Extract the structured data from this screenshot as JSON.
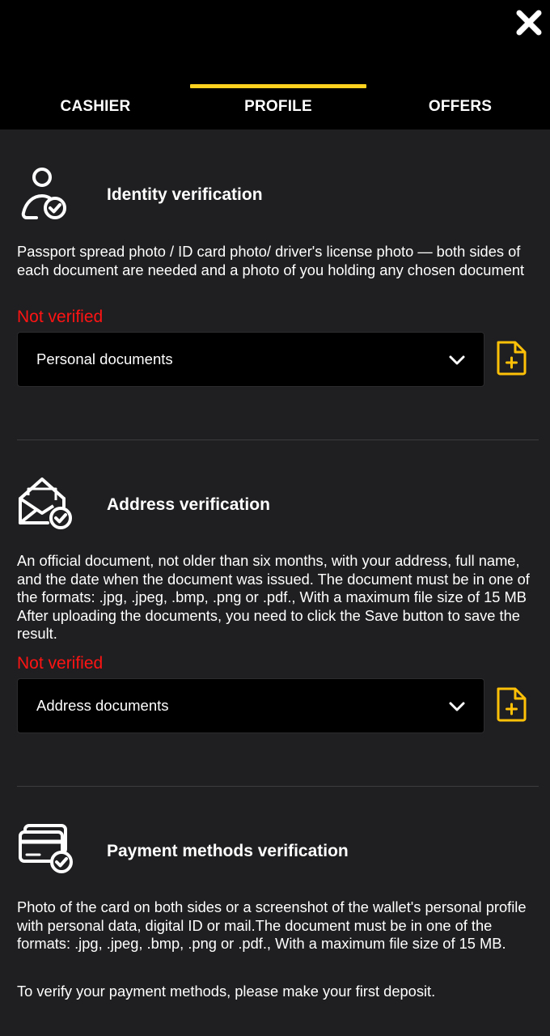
{
  "header": {
    "close_icon": "close-x-icon",
    "tabs": [
      {
        "label": "CASHIER",
        "active": false
      },
      {
        "label": "PROFILE",
        "active": true
      },
      {
        "label": "OFFERS",
        "active": false
      }
    ],
    "active_tab_color": "#ffd21f"
  },
  "sections": {
    "identity": {
      "icon": "user-check-icon",
      "title": "Identity verification",
      "description": "Passport spread photo / ID card photo/ driver's license photo — both sides of each document are needed and a photo of you holding any chosen document",
      "status": "Not verified",
      "select_value": "Personal documents",
      "upload_icon": "file-add-icon"
    },
    "address": {
      "icon": "envelope-check-icon",
      "title": "Address verification",
      "description": "An official document, not older than six months, with your address, full name, and the date when the document was issued. The document must be in one of the formats: .jpg, .jpeg, .bmp, .png or .pdf., With a maximum file size of 15 MB After uploading the documents, you need to click the Save button to save the result.",
      "status": "Not verified",
      "select_value": "Address documents",
      "upload_icon": "file-add-icon"
    },
    "payment": {
      "icon": "cards-check-icon",
      "title": "Payment methods verification",
      "description": "Photo of the card on both sides or a screenshot of the wallet's personal profile with personal data, digital ID or mail.The document must be in one of the formats: .jpg, .jpeg, .bmp, .png or .pdf., With a maximum file size of 15 MB.",
      "note": "To verify your payment methods, please make your first deposit."
    }
  },
  "colors": {
    "background": "#1f1f21",
    "header_bg": "#000000",
    "status_red": "#ff1414",
    "accent_yellow": "#ffc107"
  }
}
